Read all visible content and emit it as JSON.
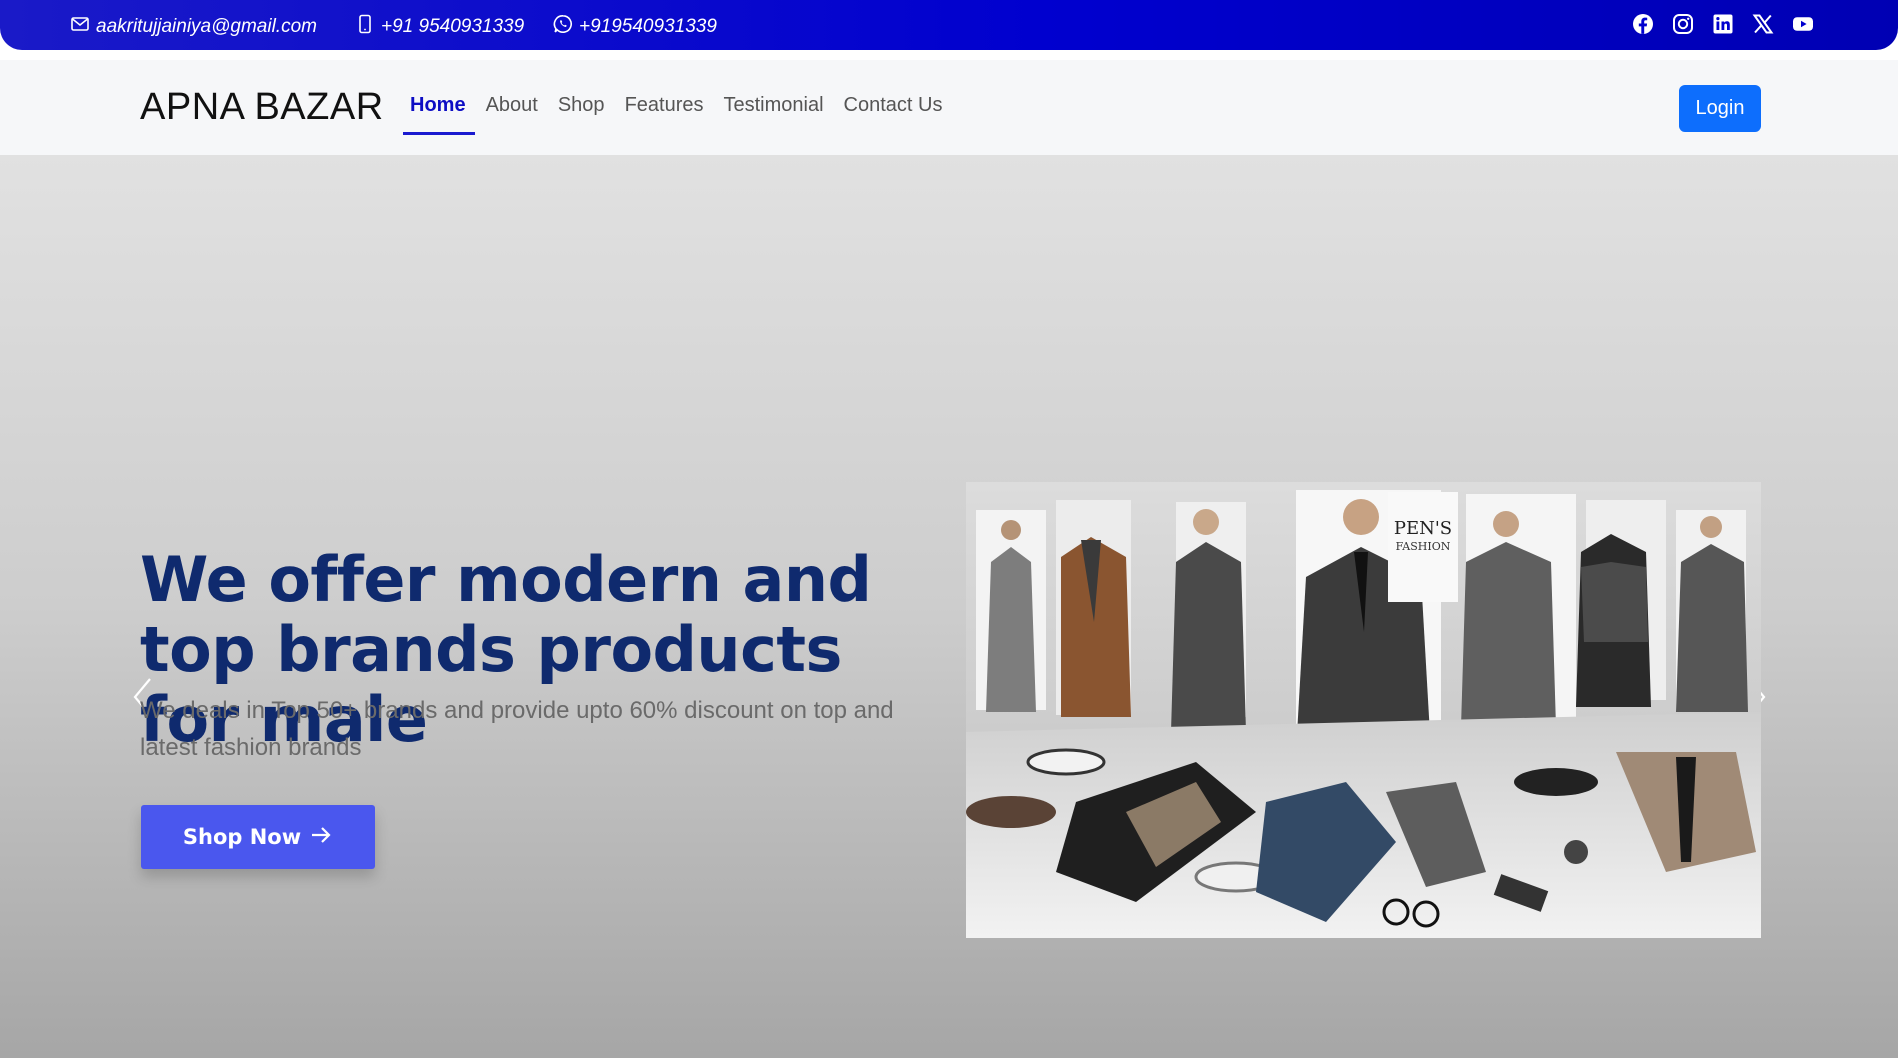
{
  "topbar": {
    "email": "aakritujjainiya@gmail.com",
    "phone": "+91 9540931339",
    "whatsapp": "+919540931339",
    "socials": [
      "facebook-icon",
      "instagram-icon",
      "linkedin-icon",
      "x-icon",
      "youtube-icon"
    ]
  },
  "navbar": {
    "brand": "APNA BAZAR",
    "links": [
      "Home",
      "About",
      "Shop",
      "Features",
      "Testimonial",
      "Contact Us"
    ],
    "active": "Home",
    "login_label": "Login"
  },
  "hero": {
    "title": "We offer modern and top brands products for male",
    "subtitle": "We deals in Top 50+ brands and provide upto 60% discount on top and latest fashion brands",
    "cta_label": "Shop Now",
    "image_sign_line1": "PEN'S",
    "image_sign_line2": "FASHION"
  },
  "colors": {
    "topbar": "#0000cf",
    "brand_text": "#111111",
    "nav_active": "#0d0dc4",
    "login_button": "#0d6efd",
    "hero_title": "#0f2a6e",
    "cta_button": "#4a57ee"
  }
}
